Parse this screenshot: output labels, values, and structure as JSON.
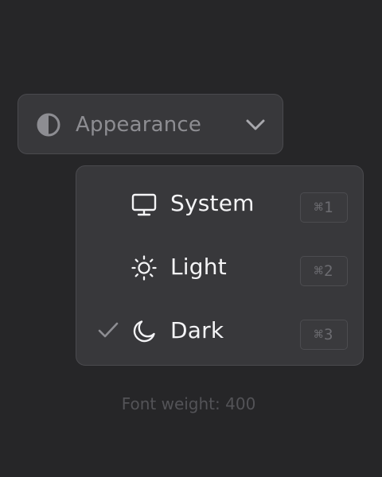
{
  "trigger": {
    "icon": "contrast-icon",
    "label": "Appearance",
    "chevron": "chevron-down-icon"
  },
  "menu": {
    "items": [
      {
        "label": "System",
        "icon": "monitor-icon",
        "shortcut": "⌘1",
        "selected": false
      },
      {
        "label": "Light",
        "icon": "sun-icon",
        "shortcut": "⌘2",
        "selected": false
      },
      {
        "label": "Dark",
        "icon": "moon-icon",
        "shortcut": "⌘3",
        "selected": true
      }
    ]
  },
  "footer": {
    "note": "Font weight: 400"
  },
  "colors": {
    "background": "#262628",
    "surface": "#38383b",
    "border": "#4a4a4e",
    "text_primary": "#f4f4f6",
    "text_muted": "#8d8d92",
    "text_faint": "#535357"
  }
}
